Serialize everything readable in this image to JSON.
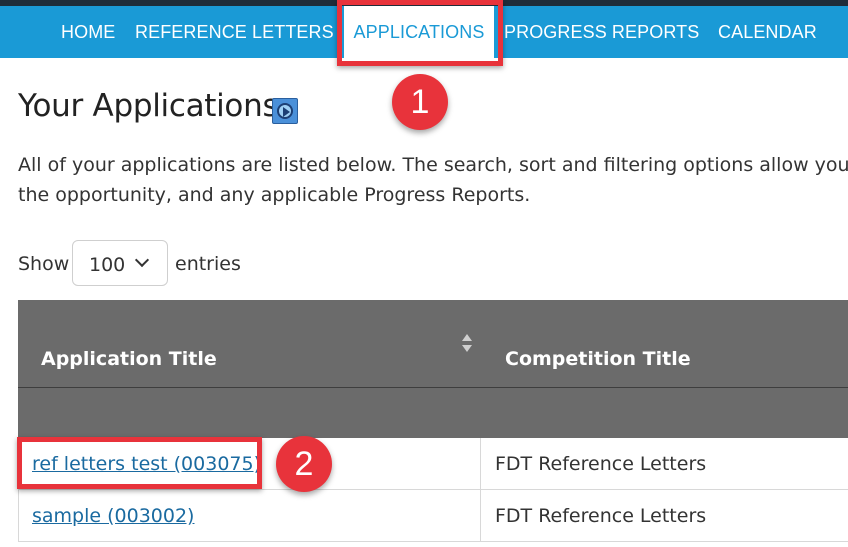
{
  "nav": {
    "items": [
      {
        "label": "HOME"
      },
      {
        "label": "REFERENCE LETTERS"
      },
      {
        "label": "APPLICATIONS"
      },
      {
        "label": "PROGRESS REPORTS"
      },
      {
        "label": "CALENDAR"
      }
    ],
    "active": "APPLICATIONS"
  },
  "callouts": {
    "step1": "1",
    "step2": "2"
  },
  "page": {
    "title": "Your Applications",
    "intro_line1": "All of your applications are listed below. The search, sort and filtering options allow you to o",
    "intro_line2": "the opportunity, and any applicable Progress Reports."
  },
  "entries": {
    "show_label": "Show",
    "value": "100",
    "suffix": "entries"
  },
  "table": {
    "columns": [
      "Application Title",
      "Competition Title"
    ],
    "rows": [
      {
        "application": "ref letters test (003075)",
        "competition": "FDT Reference Letters"
      },
      {
        "application": "sample (003002)",
        "competition": "FDT Reference Letters"
      }
    ]
  },
  "colors": {
    "nav_bg": "#1a9ad6",
    "highlight": "#e8333b",
    "header_bg": "#6b6b6b",
    "link": "#1a6aa0"
  },
  "icons": [
    "video-play-icon",
    "sort-icon",
    "chevron-down-icon"
  ]
}
